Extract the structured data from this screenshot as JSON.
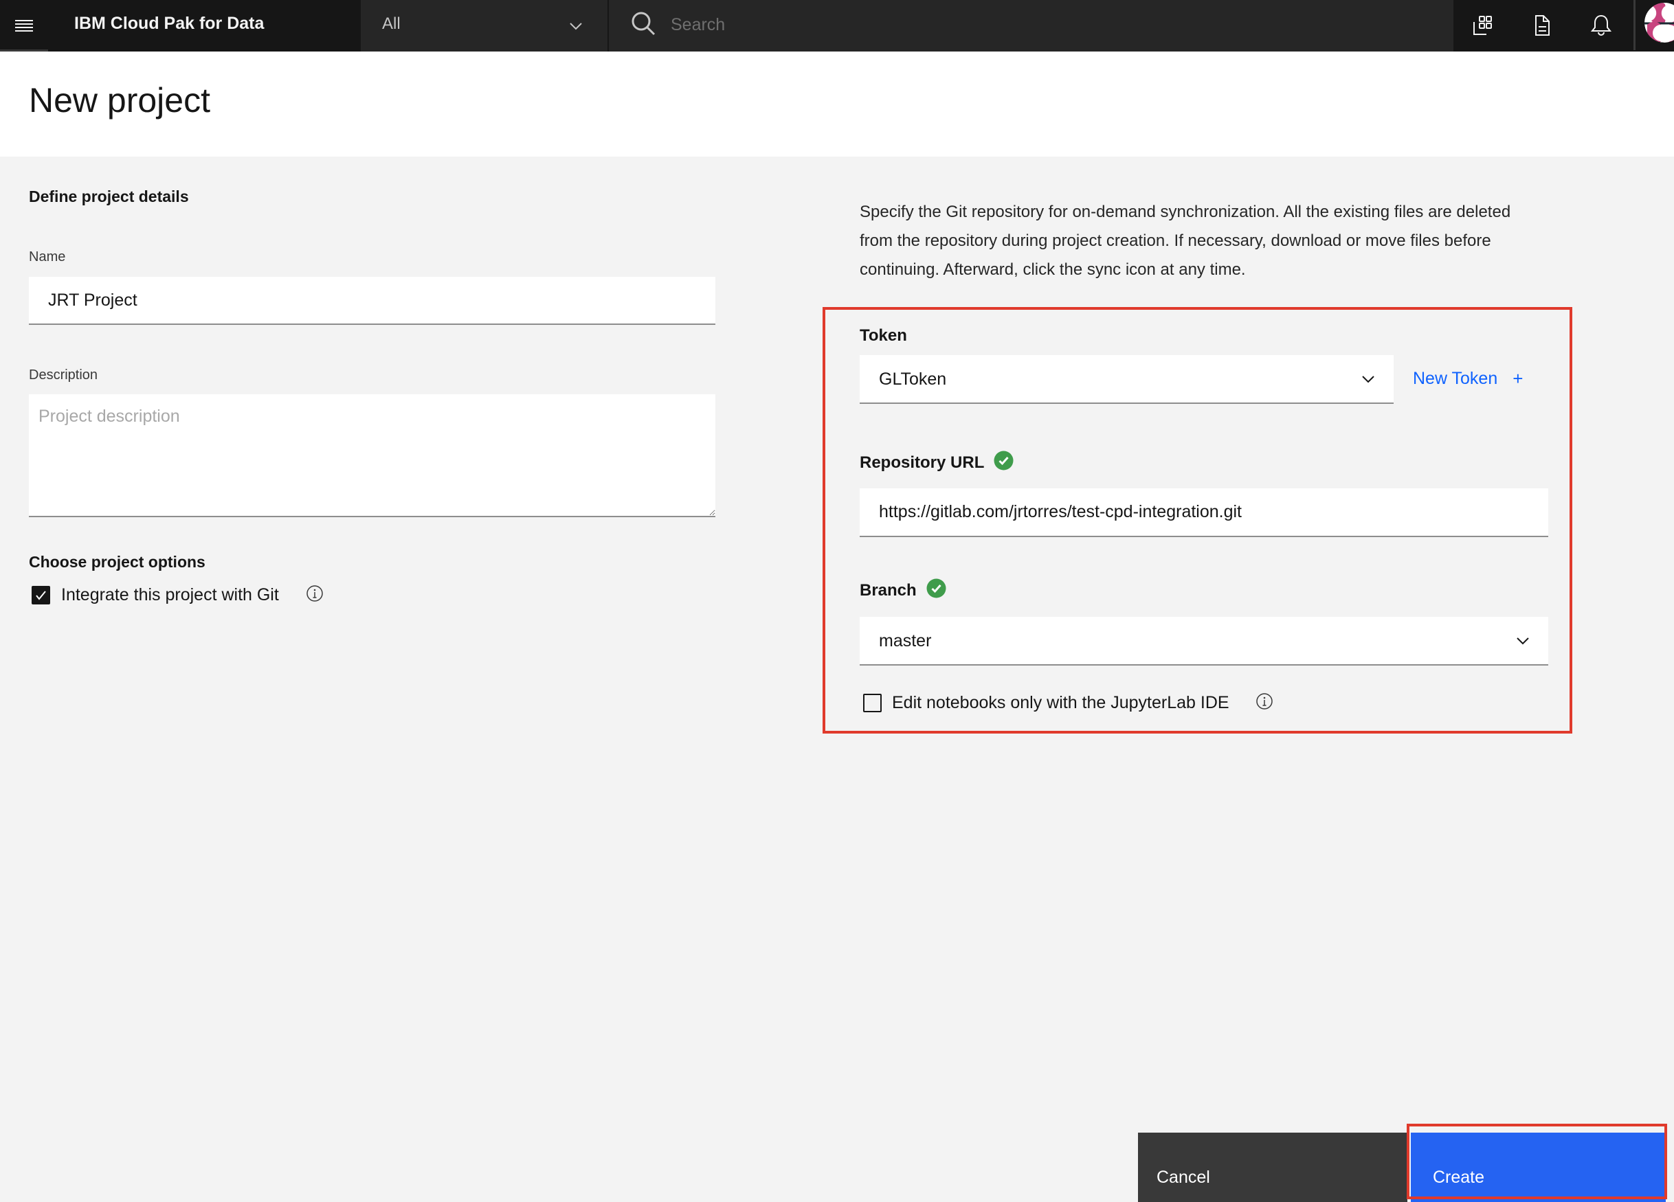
{
  "header": {
    "app_title": "IBM Cloud Pak for Data",
    "scope_selected": "All",
    "search_placeholder": "Search",
    "icons": [
      "menu-icon",
      "chevron-down-icon",
      "search-icon",
      "catalog-icon",
      "document-icon",
      "notification-bell-icon",
      "user-avatar"
    ]
  },
  "page": {
    "title": "New project"
  },
  "details": {
    "heading": "Define project details",
    "name_label": "Name",
    "name_value": "JRT Project",
    "description_label": "Description",
    "description_placeholder": "Project description",
    "description_value": ""
  },
  "options": {
    "heading": "Choose project options",
    "git_checkbox_label": "Integrate this project with Git",
    "git_checkbox_checked": true
  },
  "git": {
    "description": "Specify the Git repository for on-demand synchronization. All the existing files are deleted from the repository during project creation. If necessary, download or move files before continuing. Afterward, click the sync icon at any time.",
    "token_label": "Token",
    "token_value": "GLToken",
    "new_token_label": "New Token",
    "repo_url_label": "Repository URL",
    "repo_url_value": "https://gitlab.com/jrtorres/test-cpd-integration.git",
    "repo_url_valid": true,
    "branch_label": "Branch",
    "branch_value": "master",
    "branch_valid": true,
    "jupyter_checkbox_label": "Edit notebooks only with the JupyterLab IDE",
    "jupyter_checkbox_checked": false
  },
  "footer": {
    "cancel_label": "Cancel",
    "create_label": "Create"
  },
  "colors": {
    "header_bg": "#161616",
    "primary_button": "#2563f2",
    "secondary_button": "#393939",
    "link": "#0f62fe",
    "success": "#42be65",
    "highlight": "#e03a2c"
  }
}
